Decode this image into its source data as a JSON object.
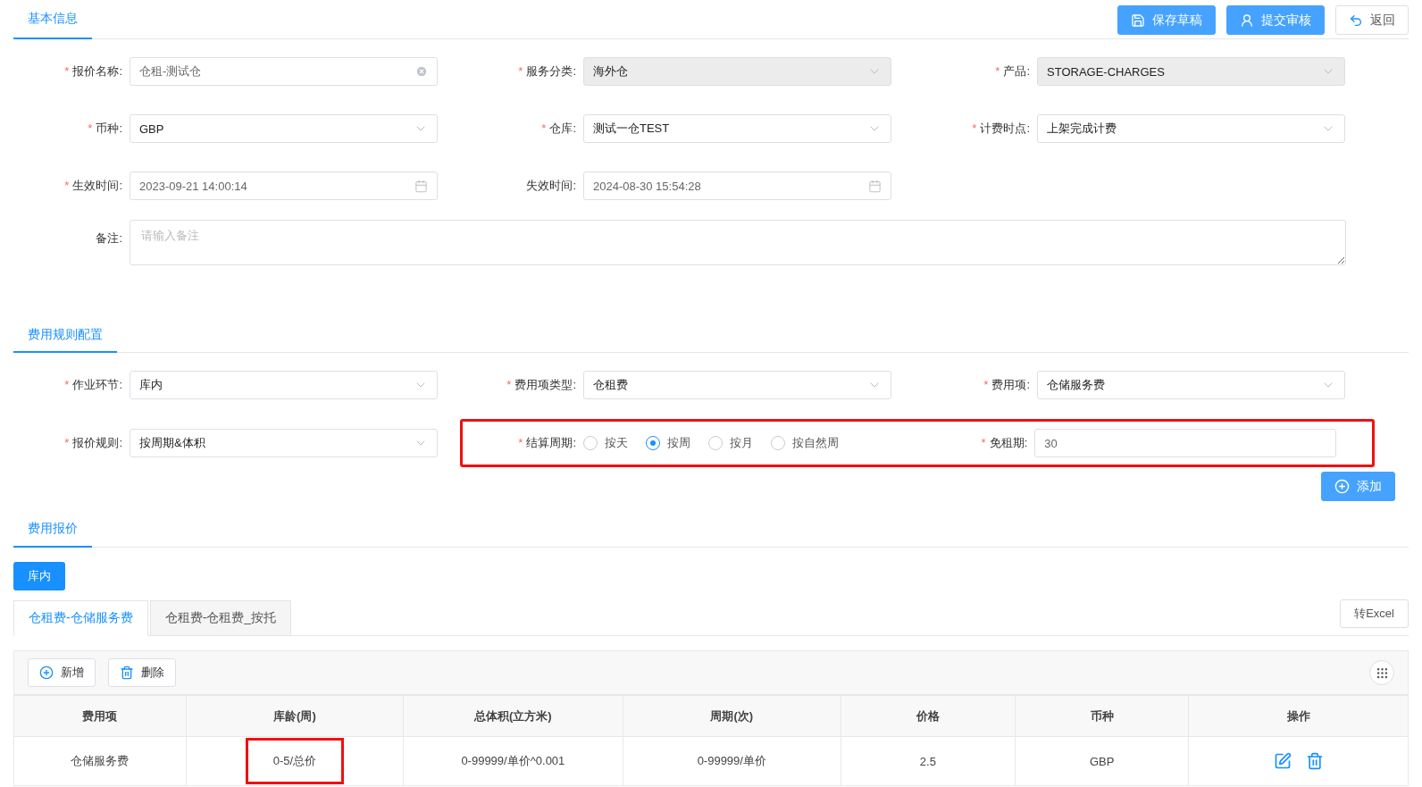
{
  "header": {
    "tab": {
      "label": "基本信息",
      "selected": true
    },
    "buttons": [
      {
        "label": "保存草稿",
        "kind": "save",
        "primary": true
      },
      {
        "label": "提交审核",
        "kind": "submit",
        "primary": true
      },
      {
        "label": "返回",
        "kind": "back",
        "primary": false
      }
    ]
  },
  "basic_info": {
    "rows": [
      [
        {
          "marker": "*",
          "label": "报价名称:",
          "kind": "text",
          "value": "仓租-测试仓",
          "clearable": true
        },
        {
          "marker": "*",
          "label": "服务分类:",
          "kind": "select",
          "value": "海外仓",
          "disabled": true
        },
        {
          "marker": "*",
          "label": "产品:",
          "kind": "select",
          "value": "STORAGE-CHARGES",
          "disabled": true
        }
      ],
      [
        {
          "marker": "*",
          "label": "币种:",
          "kind": "select",
          "value": "GBP",
          "disabled": false
        },
        {
          "marker": "*",
          "label": "仓库:",
          "kind": "select",
          "value": "测试一仓TEST",
          "disabled": false
        },
        {
          "marker": "*",
          "label": "计费时点:",
          "kind": "select",
          "value": "上架完成计费",
          "disabled": false
        }
      ],
      [
        {
          "marker": "*",
          "label": "生效时间:",
          "kind": "date",
          "value": "2023-09-21 14:00:14"
        },
        {
          "label": "失效时间:",
          "kind": "date",
          "value": "2024-08-30 15:54:28"
        }
      ]
    ],
    "remarks": {
      "label": "备注:",
      "placeholder": "请输入备注"
    }
  },
  "rule_config": {
    "tab": {
      "label": "费用规则配置",
      "selected": true
    },
    "fields": [
      {
        "marker": "*",
        "label": "作业环节:",
        "kind": "select",
        "value": "库内",
        "disabled": false
      },
      {
        "marker": "*",
        "label": "费用项类型:",
        "kind": "select",
        "value": "仓租费",
        "disabled": false
      },
      {
        "marker": "*",
        "label": "费用项:",
        "kind": "select",
        "value": "仓储服务费",
        "disabled": false
      }
    ],
    "quote_rule": {
      "marker": "*",
      "label": "报价规则:",
      "kind": "select",
      "value": "按周期&体积",
      "disabled": false
    },
    "highlight": {
      "highlighted": true,
      "fields": [
        {
          "marker": "*",
          "label": "结算周期:",
          "kind": "radio",
          "options": [
            {
              "label": "按天",
              "selected": false
            },
            {
              "label": "按周",
              "selected": true
            },
            {
              "label": "按月",
              "selected": false
            },
            {
              "label": "按自然周",
              "selected": false
            }
          ]
        },
        {
          "marker": "*",
          "label": "免租期:",
          "kind": "text",
          "value": "30"
        }
      ]
    },
    "add_button": "添加"
  },
  "quotes": {
    "tab": {
      "label": "费用报价",
      "selected": true
    },
    "stages": [
      {
        "label": "库内",
        "selected": true
      }
    ],
    "sub_tabs": [
      {
        "label": "仓租费-仓储服务费",
        "selected": true
      },
      {
        "label": "仓租费-仓租费_按托",
        "selected": false
      }
    ],
    "export_button": "转Excel",
    "toolbar": [
      {
        "label": "新增",
        "kind": "add"
      },
      {
        "label": "删除",
        "kind": "delete"
      }
    ],
    "table": {
      "columns": [
        "费用项",
        "库龄(周)",
        "总体积(立方米)",
        "周期(次)",
        "价格",
        "币种",
        "操作"
      ],
      "rows": [
        {
          "cells": [
            {
              "text": "仓储服务费",
              "highlighted": false
            },
            {
              "text": "0-5/总价",
              "highlighted": true
            },
            {
              "text": "0-99999/单价^0.001",
              "highlighted": false
            },
            {
              "text": "0-99999/单价",
              "highlighted": false
            },
            {
              "text": "2.5",
              "highlighted": false
            },
            {
              "text": "GBP",
              "highlighted": false
            }
          ],
          "actions": [
            {
              "kind": "edit"
            },
            {
              "kind": "delete"
            }
          ]
        }
      ]
    }
  }
}
